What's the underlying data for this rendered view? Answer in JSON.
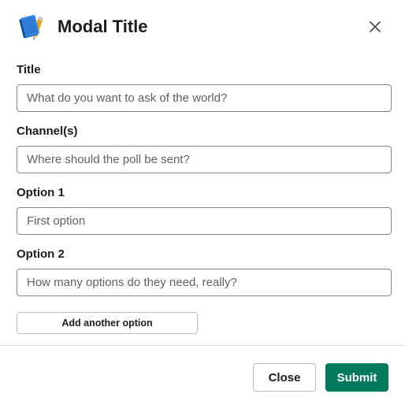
{
  "modal": {
    "title": "Modal Title",
    "app_icon": "notebook-icon",
    "close_icon": "close-icon"
  },
  "fields": [
    {
      "label": "Title",
      "value": "",
      "placeholder": "What do you want to ask of the world?"
    },
    {
      "label": "Channel(s)",
      "value": "",
      "placeholder": "Where should the poll be sent?"
    },
    {
      "label": "Option 1",
      "value": "",
      "placeholder": "First option"
    },
    {
      "label": "Option 2",
      "value": "",
      "placeholder": "How many options do they need, really?"
    }
  ],
  "add_option_label": "Add another option",
  "footer": {
    "close_label": "Close",
    "submit_label": "Submit"
  },
  "colors": {
    "accent": "#007a5a",
    "text": "#1d1c1d",
    "border": "#868686",
    "placeholder": "#616061"
  }
}
